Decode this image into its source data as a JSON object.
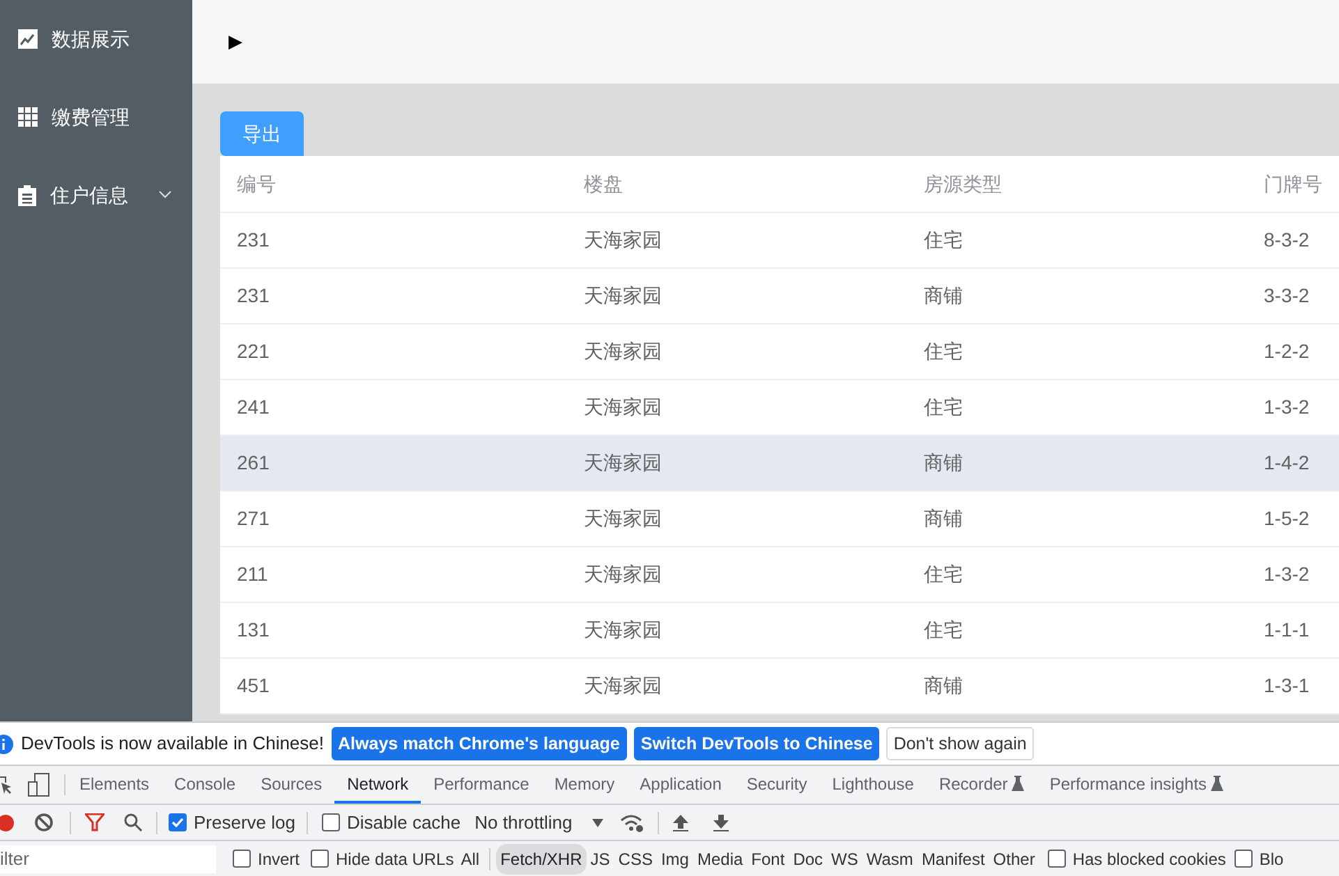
{
  "sidebar": {
    "items": [
      {
        "label": "数据展示",
        "expandable": false
      },
      {
        "label": "缴费管理",
        "expandable": false
      },
      {
        "label": "住户信息",
        "expandable": true
      }
    ]
  },
  "toolbar": {
    "toggle": "▶"
  },
  "export_button": "导出",
  "table": {
    "columns": [
      "编号",
      "楼盘",
      "房源类型",
      "门牌号"
    ],
    "rows": [
      {
        "cells": [
          "231",
          "天海家园",
          "住宅",
          "8-3-2"
        ],
        "highlighted": false
      },
      {
        "cells": [
          "231",
          "天海家园",
          "商铺",
          "3-3-2"
        ],
        "highlighted": false
      },
      {
        "cells": [
          "221",
          "天海家园",
          "住宅",
          "1-2-2"
        ],
        "highlighted": false
      },
      {
        "cells": [
          "241",
          "天海家园",
          "住宅",
          "1-3-2"
        ],
        "highlighted": false
      },
      {
        "cells": [
          "261",
          "天海家园",
          "商铺",
          "1-4-2"
        ],
        "highlighted": true
      },
      {
        "cells": [
          "271",
          "天海家园",
          "商铺",
          "1-5-2"
        ],
        "highlighted": false
      },
      {
        "cells": [
          "211",
          "天海家园",
          "住宅",
          "1-3-2"
        ],
        "highlighted": false
      },
      {
        "cells": [
          "131",
          "天海家园",
          "住宅",
          "1-1-1"
        ],
        "highlighted": false
      },
      {
        "cells": [
          "451",
          "天海家园",
          "商铺",
          "1-3-1"
        ],
        "highlighted": false
      }
    ]
  },
  "devtools": {
    "infobar": {
      "message": "DevTools is now available in Chinese!",
      "buttons": [
        {
          "label": "Always match Chrome's language",
          "kind": "primary"
        },
        {
          "label": "Switch DevTools to Chinese",
          "kind": "primary"
        },
        {
          "label": "Don't show again",
          "kind": "secondary"
        }
      ]
    },
    "tabs": [
      {
        "label": "Elements",
        "selected": false,
        "experimental": false
      },
      {
        "label": "Console",
        "selected": false,
        "experimental": false
      },
      {
        "label": "Sources",
        "selected": false,
        "experimental": false
      },
      {
        "label": "Network",
        "selected": true,
        "experimental": false
      },
      {
        "label": "Performance",
        "selected": false,
        "experimental": false
      },
      {
        "label": "Memory",
        "selected": false,
        "experimental": false
      },
      {
        "label": "Application",
        "selected": false,
        "experimental": false
      },
      {
        "label": "Security",
        "selected": false,
        "experimental": false
      },
      {
        "label": "Lighthouse",
        "selected": false,
        "experimental": false
      },
      {
        "label": "Recorder",
        "selected": false,
        "experimental": true
      },
      {
        "label": "Performance insights",
        "selected": false,
        "experimental": true
      }
    ],
    "preserve_log": {
      "label": "Preserve log",
      "checked": true
    },
    "disable_cache": {
      "label": "Disable cache",
      "checked": false
    },
    "throttling": "No throttling",
    "filter": {
      "placeholder": "ilter"
    },
    "invert": {
      "label": "Invert",
      "checked": false
    },
    "hide_data_urls": {
      "label": "Hide data URLs",
      "checked": false
    },
    "types": [
      {
        "label": "All",
        "selected": false
      },
      {
        "label": "Fetch/XHR",
        "selected": true
      },
      {
        "label": "JS",
        "selected": false
      },
      {
        "label": "CSS",
        "selected": false
      },
      {
        "label": "Img",
        "selected": false
      },
      {
        "label": "Media",
        "selected": false
      },
      {
        "label": "Font",
        "selected": false
      },
      {
        "label": "Doc",
        "selected": false
      },
      {
        "label": "WS",
        "selected": false
      },
      {
        "label": "Wasm",
        "selected": false
      },
      {
        "label": "Manifest",
        "selected": false
      },
      {
        "label": "Other",
        "selected": false
      }
    ],
    "has_blocked_cookies": {
      "label": "Has blocked cookies",
      "checked": false
    },
    "blocked": {
      "label": "Blo",
      "checked": false
    }
  }
}
